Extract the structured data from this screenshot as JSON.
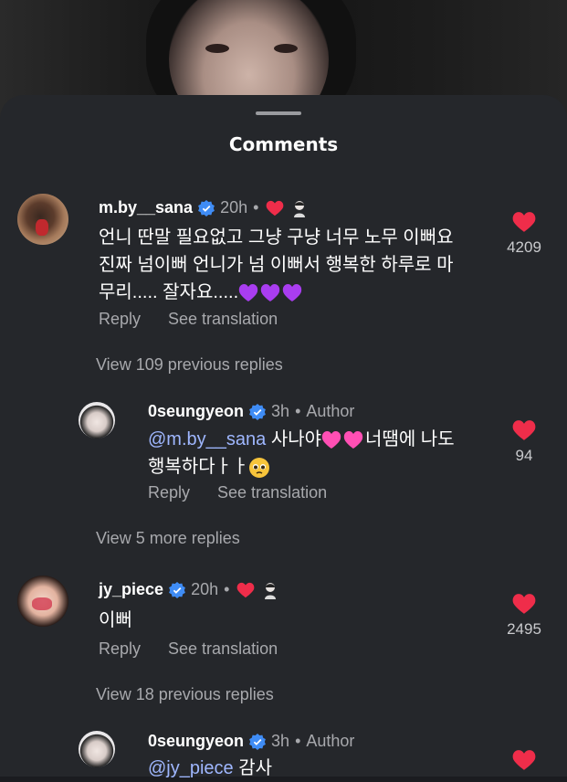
{
  "colors": {
    "sheet_bg": "#25272b",
    "heart": "#ef2d4a",
    "verified": "#3f8cf5",
    "mention": "#9fb7ff",
    "muted": "#a8a9ad"
  },
  "sheet": {
    "title": "Comments"
  },
  "comments": [
    {
      "username": "m.by__sana",
      "time": "20h",
      "body_lines": [
        "언니 딴말 필요없고 그냥 구냥 너무 노무 이뻐요",
        "진짜 넘이뻐 언니가 넘 이뻐서 행복한 하루로 마",
        "무리..... 잘자요....."
      ],
      "trailing_emoji": "purple-hearts",
      "reply_label": "Reply",
      "translate_label": "See translation",
      "likes": "4209",
      "view_more": "View 109 previous replies"
    },
    {
      "username": "0seungyeon",
      "time": "3h",
      "author_label": "Author",
      "mention": "@m.by__sana",
      "body_after_mention": " 사나야",
      "body_after_hearts": "너땜에 나도",
      "body_line2": "행복하다ㅏㅏ",
      "reply_label": "Reply",
      "translate_label": "See translation",
      "likes": "94",
      "view_more": "View 5 more replies"
    },
    {
      "username": "jy_piece",
      "time": "20h",
      "body": "이뻐",
      "reply_label": "Reply",
      "translate_label": "See translation",
      "likes": "2495",
      "view_more": "View 18 previous replies"
    },
    {
      "username": "0seungyeon",
      "time": "3h",
      "author_label": "Author",
      "mention": "@jy_piece",
      "body_after_mention": " 감사"
    }
  ],
  "separator_dot": "•"
}
